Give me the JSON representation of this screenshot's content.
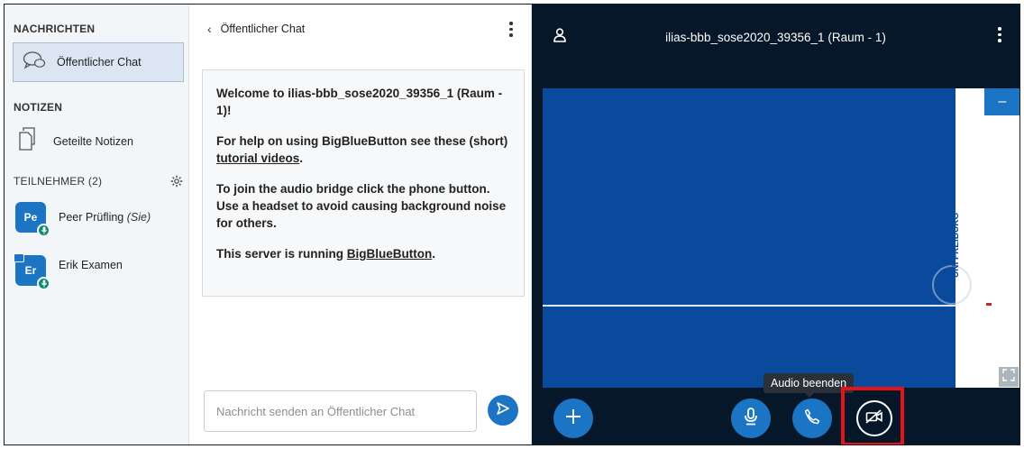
{
  "sidebar": {
    "messages_heading": "NACHRICHTEN",
    "public_chat_label": "Öffentlicher Chat",
    "notes_heading": "NOTIZEN",
    "shared_notes_label": "Geteilte Notizen",
    "participants_heading": "TEILNEHMER (2)",
    "users": [
      {
        "initials": "Pe",
        "name": "Peer Prüfling",
        "suffix": "(Sie)",
        "presenter": false
      },
      {
        "initials": "Er",
        "name": "Erik Examen",
        "suffix": "",
        "presenter": true
      }
    ]
  },
  "chat": {
    "title": "Öffentlicher Chat",
    "welcome": {
      "line1": "Welcome to ilias-bbb_sose2020_39356_1 (Raum - 1)!",
      "help_prefix": "For help on using BigBlueButton see these (short) ",
      "help_link": "tutorial videos",
      "help_suffix": ".",
      "audio_text": "To join the audio bridge click the phone button. Use a headset to avoid causing background noise for others.",
      "server_prefix": "This server is running ",
      "server_link": "BigBlueButton",
      "server_suffix": "."
    },
    "input_placeholder": "Nachricht senden an Öffentlicher Chat"
  },
  "stage": {
    "title": "ilias-bbb_sose2020_39356_1 (Raum - 1)",
    "slide_logo_text": "UNI FREIBURG",
    "minimize_label": "–",
    "tooltip": "Audio beenden"
  },
  "colors": {
    "accent": "#1b75c4",
    "stage_bg": "#06172a",
    "highlight": "#e4141b"
  }
}
